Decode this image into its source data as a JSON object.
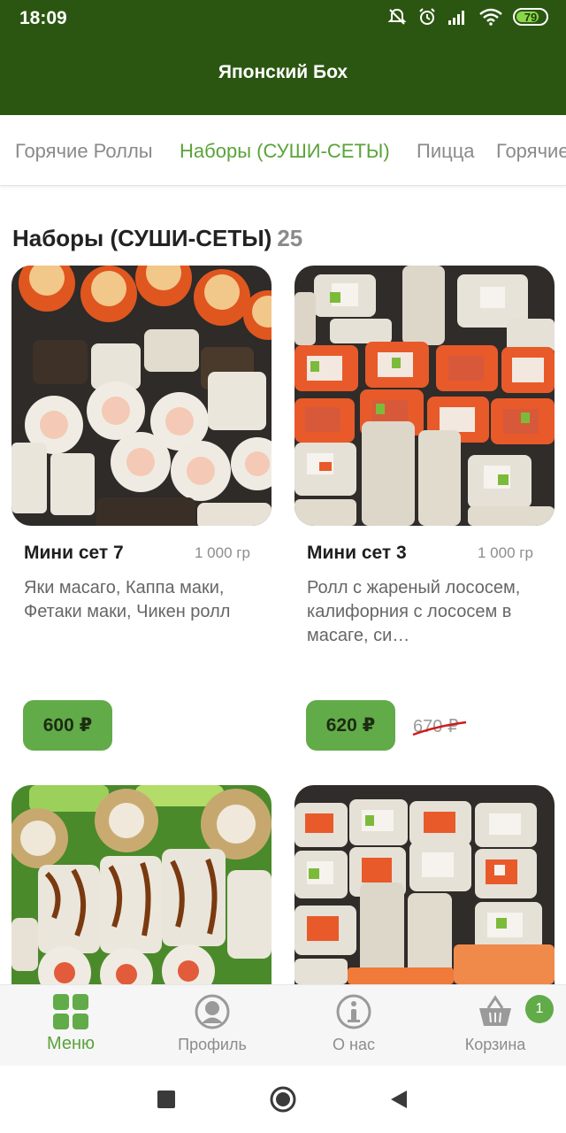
{
  "status_bar": {
    "time": "18:09",
    "battery": "79",
    "icons": [
      "alarm-off-icon",
      "alarm-icon",
      "signal-icon",
      "wifi-icon",
      "battery-icon"
    ]
  },
  "app_bar": {
    "title": "Японский Бох"
  },
  "category_tabs": [
    {
      "label": "Горячие Роллы",
      "active": false
    },
    {
      "label": "Наборы (СУШИ-СЕТЫ)",
      "active": true
    },
    {
      "label": "Пицца",
      "active": false
    },
    {
      "label": "Горячие",
      "active": false
    }
  ],
  "section": {
    "title": "Наборы (СУШИ-СЕТЫ)",
    "count": "25"
  },
  "products": [
    {
      "name": "Мини сет 7",
      "weight": "1 000 гр",
      "description": "Яки масаго, Каппа маки, Фетаки маки, Чикен ролл",
      "price": "600 ₽",
      "old_price": ""
    },
    {
      "name": "Мини сет 3",
      "weight": "1 000 гр",
      "description": "Ролл с жареный лососем, калифорния с лососем в масаге, си…",
      "price": "620 ₽",
      "old_price": "670 ₽"
    },
    {
      "name": "",
      "weight": "",
      "description": "",
      "price": "",
      "old_price": ""
    },
    {
      "name": "",
      "weight": "",
      "description": "",
      "price": "",
      "old_price": ""
    }
  ],
  "bottom_nav": [
    {
      "label": "Меню",
      "icon": "grid-menu-icon",
      "active": true
    },
    {
      "label": "Профиль",
      "icon": "profile-icon",
      "active": false
    },
    {
      "label": "О нас",
      "icon": "info-icon",
      "active": false
    },
    {
      "label": "Корзина",
      "icon": "basket-icon",
      "active": false,
      "badge": "1"
    }
  ],
  "system_nav": [
    "recents-icon",
    "home-icon",
    "back-icon"
  ],
  "colors": {
    "app_bar": "#2b5611",
    "accent": "#5aa33a",
    "price_button": "#62ab49",
    "strike": "#d11a1a"
  }
}
